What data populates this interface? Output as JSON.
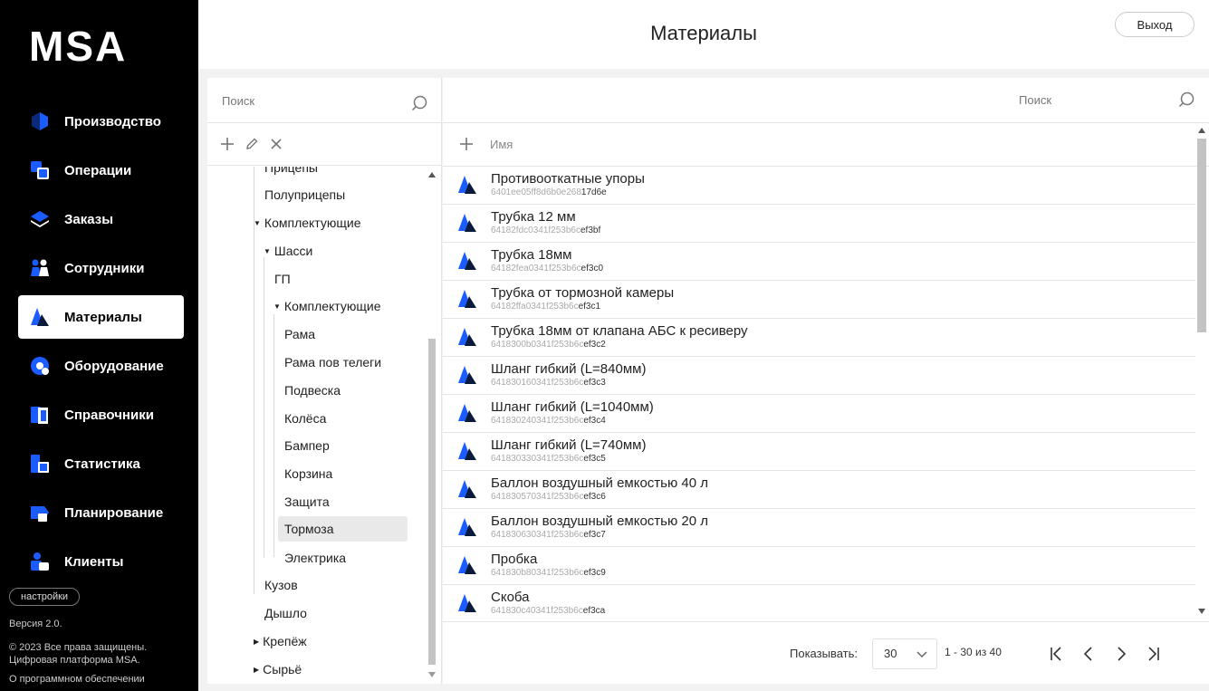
{
  "app": {
    "logo": "MSA"
  },
  "sidebar": {
    "items": [
      {
        "label": "Производство",
        "icon": "production-icon"
      },
      {
        "label": "Операции",
        "icon": "operations-icon"
      },
      {
        "label": "Заказы",
        "icon": "orders-icon"
      },
      {
        "label": "Сотрудники",
        "icon": "employees-icon"
      },
      {
        "label": "Материалы",
        "icon": "materials-icon",
        "active": true
      },
      {
        "label": "Оборудование",
        "icon": "equipment-icon"
      },
      {
        "label": "Справочники",
        "icon": "directories-icon"
      },
      {
        "label": "Статистика",
        "icon": "statistics-icon"
      },
      {
        "label": "Планирование",
        "icon": "planning-icon"
      },
      {
        "label": "Клиенты",
        "icon": "clients-icon"
      }
    ],
    "settings_label": "настройки",
    "version": "Версия 2.0.",
    "copyright_line1": "© 2023 Все права защищены.",
    "copyright_line2": "Цифровая платформа MSA.",
    "about": "О программном обеспечении"
  },
  "header": {
    "title": "Материалы",
    "logout_label": "Выход"
  },
  "tree_panel": {
    "search_placeholder": "Поиск",
    "items": [
      {
        "label": "Прицепы"
      },
      {
        "label": "Полуприцепы"
      },
      {
        "label": "Комплектующие",
        "expanded": true
      },
      {
        "label": "Шасси",
        "expanded": true
      },
      {
        "label": "ГП"
      },
      {
        "label": "Комплектующие",
        "expanded": true
      },
      {
        "label": "Рама"
      },
      {
        "label": "Рама пов телеги"
      },
      {
        "label": "Подвеска"
      },
      {
        "label": "Колёса"
      },
      {
        "label": "Бампер"
      },
      {
        "label": "Корзина"
      },
      {
        "label": "Защита"
      },
      {
        "label": "Тормоза",
        "selected": true
      },
      {
        "label": "Электрика"
      },
      {
        "label": "Кузов"
      },
      {
        "label": "Дышло"
      },
      {
        "label": "Крепёж",
        "collapsed": true
      },
      {
        "label": "Сырьё",
        "collapsed": true
      }
    ]
  },
  "list_panel": {
    "search_placeholder": "Поиск",
    "column_name": "Имя",
    "rows": [
      {
        "name": "Противооткатные упоры",
        "id_prefix": "6401ee05ff8d6b0e268",
        "id_suffix": "17d6e"
      },
      {
        "name": "Трубка 12 мм",
        "id_prefix": "64182fdc0341f253b6c",
        "id_suffix": "ef3bf"
      },
      {
        "name": "Трубка 18мм",
        "id_prefix": "64182fea0341f253b6c",
        "id_suffix": "ef3c0"
      },
      {
        "name": "Трубка от тормозной камеры",
        "id_prefix": "64182ffa0341f253b6c",
        "id_suffix": "ef3c1"
      },
      {
        "name": "Трубка 18мм от клапана АБС к ресиверу",
        "id_prefix": "6418300b0341f253b6c",
        "id_suffix": "ef3c2"
      },
      {
        "name": "Шланг гибкий (L=840мм)",
        "id_prefix": "641830160341f253b6c",
        "id_suffix": "ef3c3"
      },
      {
        "name": "Шланг гибкий (L=1040мм)",
        "id_prefix": "641830240341f253b6c",
        "id_suffix": "ef3c4"
      },
      {
        "name": "Шланг гибкий (L=740мм)",
        "id_prefix": "641830330341f253b6c",
        "id_suffix": "ef3c5"
      },
      {
        "name": "Баллон воздушный емкостью 40 л",
        "id_prefix": "641830570341f253b6c",
        "id_suffix": "ef3c6"
      },
      {
        "name": "Баллон воздушный емкостью 20 л",
        "id_prefix": "641830630341f253b6c",
        "id_suffix": "ef3c7"
      },
      {
        "name": "Пробка",
        "id_prefix": "641830b80341f253b6c",
        "id_suffix": "ef3c9"
      },
      {
        "name": "Скоба",
        "id_prefix": "641830c40341f253b6c",
        "id_suffix": "ef3ca"
      }
    ],
    "pagination": {
      "show_label": "Показывать:",
      "page_size": "30",
      "range": "1 - 30 из 40"
    }
  },
  "colors": {
    "accent_blue": "#1a5cff",
    "accent_dark": "#0a1a3a"
  }
}
